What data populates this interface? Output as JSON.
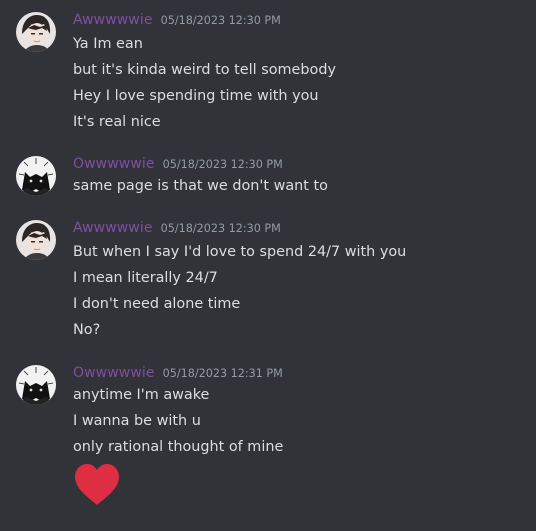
{
  "messages": [
    {
      "author": "Awwwwwie",
      "timestamp": "05/18/2023 12:30 PM",
      "avatar": "anime-portrait-avatar",
      "lines": [
        "Ya Im ean",
        "but it's kinda weird to tell somebody",
        "Hey I love spending time with you",
        "It's real nice"
      ]
    },
    {
      "author": "Owwwwwie",
      "timestamp": "05/18/2023 12:30 PM",
      "avatar": "dark-cat-avatar",
      "lines": [
        "same page is that we don't want to"
      ]
    },
    {
      "author": "Awwwwwie",
      "timestamp": "05/18/2023 12:30 PM",
      "avatar": "anime-portrait-avatar",
      "lines": [
        "But when I say I'd love to spend 24/7  with you",
        "I mean literally 24/7",
        "I don't need alone time",
        "No?"
      ]
    },
    {
      "author": "Owwwwwie",
      "timestamp": "05/18/2023 12:31 PM",
      "avatar": "dark-cat-avatar",
      "lines": [
        "anytime I'm awake",
        "I wanna be with u",
        "only rational thought of mine"
      ],
      "emoji": "red-heart-icon"
    }
  ],
  "colors": {
    "background": "#313338",
    "username": "#7e4fa3",
    "timestamp": "#949ba4",
    "text": "#dbdee1",
    "heart": "#dd2e44"
  }
}
